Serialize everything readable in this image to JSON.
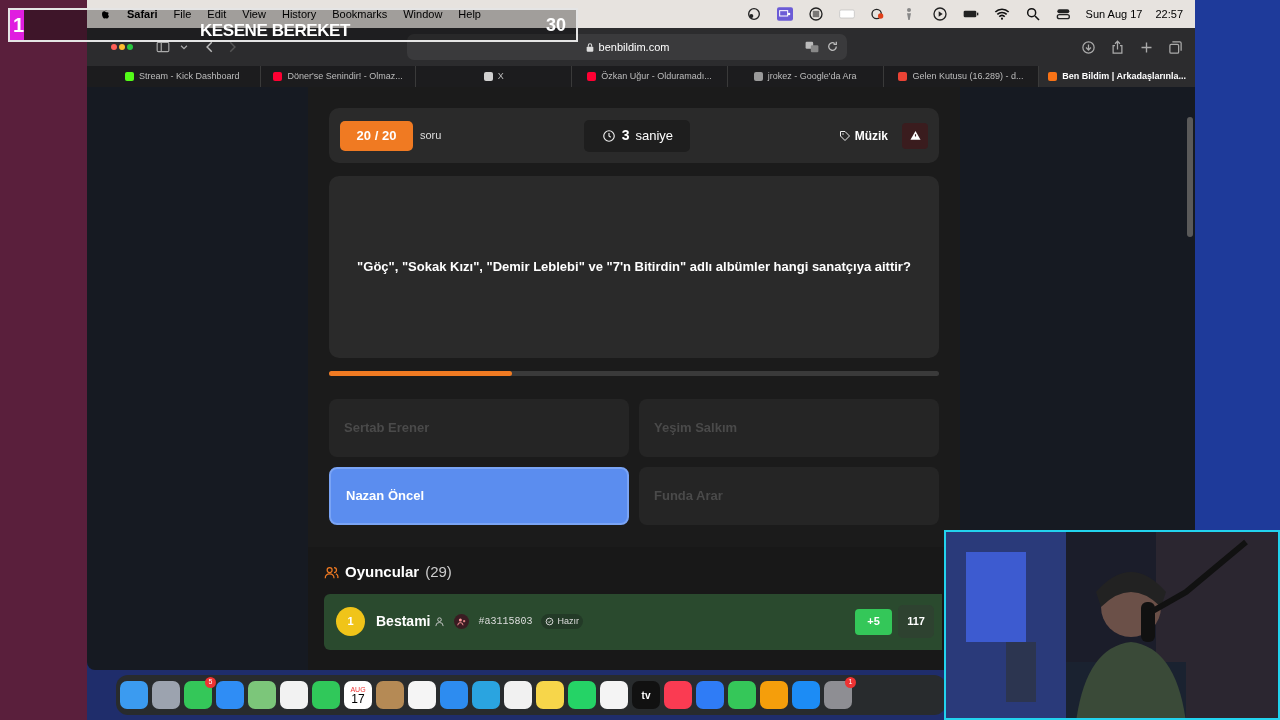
{
  "overlay": {
    "rank": "1",
    "title": "KESENE BEREKET",
    "score": "30"
  },
  "menu_bar": {
    "items": [
      {
        "label": "Safari",
        "kind": "app"
      },
      {
        "label": "File",
        "kind": "menu"
      },
      {
        "label": "Edit",
        "kind": "menu"
      },
      {
        "label": "View",
        "kind": "menu"
      },
      {
        "label": "History",
        "kind": "menu"
      },
      {
        "label": "Bookmarks",
        "kind": "menu"
      },
      {
        "label": "Window",
        "kind": "menu"
      },
      {
        "label": "Help",
        "kind": "menu"
      }
    ],
    "date": "Sun Aug 17",
    "time": "22:57"
  },
  "browser": {
    "address": "benbildim.com",
    "tabs": [
      {
        "label": "Stream - Kick Dashboard",
        "color": "#53fc18",
        "selected": false
      },
      {
        "label": "Döner'se Senindir! - Olmaz...",
        "color": "#ff0033",
        "selected": false
      },
      {
        "label": "X",
        "color": "#d0d0d0",
        "selected": false
      },
      {
        "label": "Özkan Uğur - Olduramadı...",
        "color": "#ff0033",
        "selected": false
      },
      {
        "label": "jrokez - Google'da Ara",
        "color": "#9a9a9a",
        "selected": false
      },
      {
        "label": "Gelen Kutusu (16.289) - d...",
        "color": "#ea4335",
        "selected": false
      },
      {
        "label": "Ben Bildim | Arkadaşlarınla...",
        "color": "#f97316",
        "selected": true
      }
    ]
  },
  "quiz": {
    "counter": "20 / 20",
    "counter_label": "soru",
    "timer": "3",
    "timer_unit": "saniye",
    "category": "Müzik",
    "question": "\"Göç\", \"Sokak Kızı\", \"Demir Leblebi\" ve \"7'n Bitirdin\" adlı albümler hangi sanatçıya aittir?",
    "progress": {
      "level": 0.3
    },
    "answers": [
      {
        "label": "Sertab Erener",
        "selected": false
      },
      {
        "label": "Yeşim Salkım",
        "selected": false
      },
      {
        "label": "Nazan Öncel",
        "selected": true
      },
      {
        "label": "Funda Arar",
        "selected": false
      }
    ]
  },
  "players": {
    "title": "Oyuncular",
    "count": "(29)",
    "rows": [
      {
        "rank": "1",
        "name": "Bestami",
        "tag": "#a3115803",
        "status": "Hazır",
        "gain": "+5",
        "score": "117"
      }
    ]
  },
  "dock": [
    {
      "color": "#3b9bf0"
    },
    {
      "color": "#9ca3af"
    },
    {
      "color": "#34c759",
      "badge": "5"
    },
    {
      "color": "#2f8df5"
    },
    {
      "color": "#7cc67a"
    },
    {
      "color": "#f2f2f2"
    },
    {
      "color": "#30c85a"
    },
    {
      "color": "#ffffff",
      "month": "AUG",
      "day": "17"
    },
    {
      "color": "#b58a55"
    },
    {
      "color": "#f5f5f5"
    },
    {
      "color": "#2d8cf0"
    },
    {
      "color": "#2aa4e0"
    },
    {
      "color": "#f1f1f1"
    },
    {
      "color": "#f7d64a"
    },
    {
      "color": "#25d366"
    },
    {
      "color": "#f4f4f4"
    },
    {
      "color": "#111111",
      "label": "tv"
    },
    {
      "color": "#fa3b52"
    },
    {
      "color": "#2f7cf6"
    },
    {
      "color": "#35c759"
    },
    {
      "color": "#f59e0b"
    },
    {
      "color": "#1c8cf5"
    },
    {
      "color": "#8e8e93",
      "badge": "1"
    }
  ]
}
